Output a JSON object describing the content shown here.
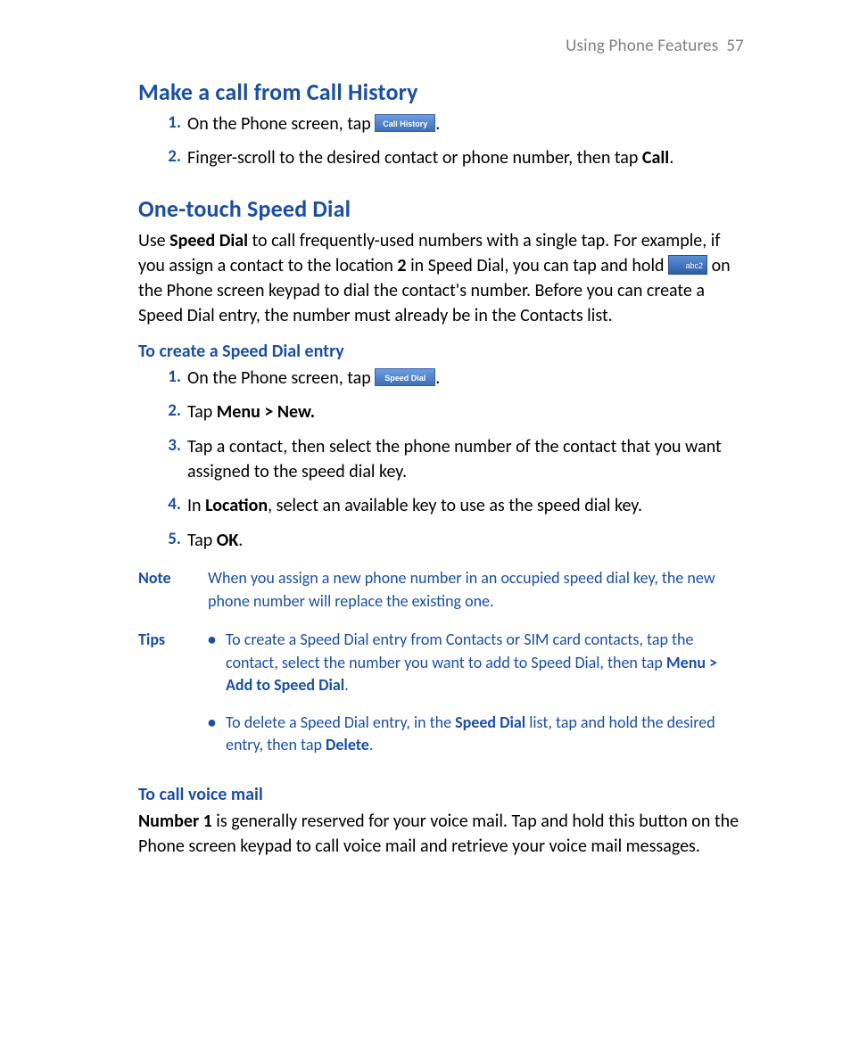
{
  "header": {
    "section": "Using Phone Features",
    "page": "57"
  },
  "section_call_history": {
    "title": "Make a call from Call History",
    "steps": [
      {
        "pre": "On the Phone screen, tap  ",
        "btn": "Call History",
        "post": "."
      },
      {
        "text_pre": "Finger-scroll to the desired contact or phone number, then tap ",
        "bold": "Call",
        "post": "."
      }
    ]
  },
  "section_speed_dial": {
    "title": "One-touch Speed Dial",
    "intro": {
      "t1": "Use ",
      "b1": "Speed Dial",
      "t2": " to call frequently-used numbers with a single tap. For example, if you assign a contact to the location ",
      "b2": "2",
      "t3": " in Speed Dial, you can tap and hold  ",
      "key": "abc2",
      "t4": " on the Phone screen keypad to dial the contact's number. Before you can create a Speed Dial entry, the number must already be in the Contacts list."
    },
    "create": {
      "title": "To create a Speed Dial entry",
      "steps": [
        {
          "pre": "On the Phone screen, tap  ",
          "btn": "Speed Dial",
          "post": "."
        },
        {
          "pre": "Tap ",
          "bold": "Menu > New.",
          "post": ""
        },
        {
          "pre": "Tap a contact, then select the phone number of the contact that you want assigned to the speed dial key.",
          "post": ""
        },
        {
          "pre": "In ",
          "bold": "Location",
          "post": ", select an available key to use as the speed dial key."
        },
        {
          "pre": "Tap ",
          "bold": "OK",
          "post": "."
        }
      ]
    },
    "note": {
      "label": "Note",
      "text": "When you assign a new phone number in an occupied speed dial key, the new phone number will replace the existing one."
    },
    "tips": {
      "label": "Tips",
      "items": [
        {
          "t1": "To create a Speed Dial entry from Contacts or SIM card contacts, tap the contact, select the number you want to add to Speed Dial, then tap ",
          "b1": "Menu > Add to Speed Dial",
          "t2": "."
        },
        {
          "t1": "To delete a Speed Dial entry, in the ",
          "b1": "Speed Dial",
          "t2": " list, tap and hold the desired entry, then tap ",
          "b2": "Delete",
          "t3": "."
        }
      ]
    },
    "voicemail": {
      "title": "To call voice mail",
      "b1": "Number 1",
      "text": " is generally reserved for your voice mail. Tap and hold this button on the Phone screen keypad to call voice mail and retrieve your voice mail messages."
    }
  }
}
